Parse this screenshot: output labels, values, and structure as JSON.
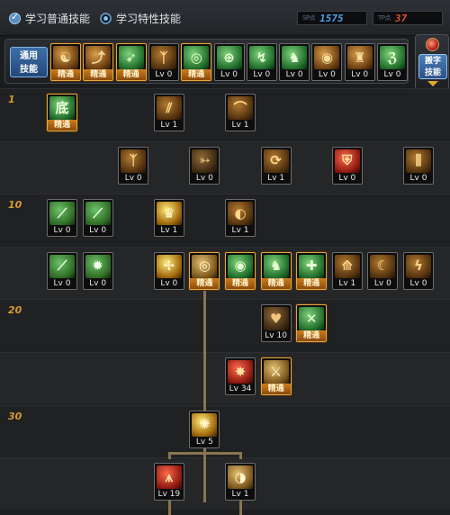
{
  "header": {
    "learn_common": "学习普通技能",
    "learn_special": "学习特性技能",
    "sp": {
      "tag": "SP点",
      "value": "1575",
      "color": "#4fa0e8"
    },
    "tp": {
      "tag": "TP点",
      "value": "37",
      "color": "#e2532b"
    }
  },
  "common_bar": {
    "label_line1": "通用",
    "label_line2": "技能",
    "skills": [
      {
        "icon": "meditate-icon",
        "glyph": "☯",
        "color": "c-gold",
        "level": "精通",
        "mastered": true
      },
      {
        "icon": "quick-rebound-icon",
        "glyph": "⤴",
        "color": "c-gold",
        "level": "精通",
        "mastered": true
      },
      {
        "icon": "dash-icon",
        "glyph": "➶",
        "color": "c-green",
        "level": "精通",
        "mastered": true
      },
      {
        "icon": "wing-icon",
        "glyph": "ᛉ",
        "color": "c-bronze",
        "level": "Lv 0",
        "mastered": false
      },
      {
        "icon": "aim-icon",
        "glyph": "◎",
        "color": "c-green",
        "level": "精通",
        "mastered": true
      },
      {
        "icon": "target-icon",
        "glyph": "⊕",
        "color": "c-green",
        "level": "Lv 0",
        "mastered": false
      },
      {
        "icon": "leap-icon",
        "glyph": "↯",
        "color": "c-green",
        "level": "Lv 0",
        "mastered": false
      },
      {
        "icon": "crouch-icon",
        "glyph": "♞",
        "color": "c-green",
        "level": "Lv 0",
        "mastered": false
      },
      {
        "icon": "orb-icon",
        "glyph": "◉",
        "color": "c-gold",
        "level": "Lv 0",
        "mastered": false
      },
      {
        "icon": "muscle-icon",
        "glyph": "♜",
        "color": "c-gold",
        "level": "Lv 0",
        "mastered": false
      },
      {
        "icon": "kick-icon",
        "glyph": "ℨ",
        "color": "c-green",
        "level": "Lv 0",
        "mastered": false
      }
    ]
  },
  "side_button": {
    "line1": "搬字",
    "line2": "技能"
  },
  "tree": {
    "level_labels": [
      "1",
      "10",
      "20",
      "30"
    ],
    "rows": [
      [
        {
          "icon": "base-skill-icon",
          "glyph": "底",
          "color": "c-green",
          "level": "精通",
          "mastered": true,
          "col": 0
        },
        {
          "icon": "claw-strike-icon",
          "glyph": "⫽",
          "color": "c-bronze",
          "level": "Lv 1",
          "mastered": false,
          "col": 3
        },
        {
          "icon": "slash-arc-icon",
          "glyph": "⌒",
          "color": "c-bronze",
          "level": "Lv 1",
          "mastered": false,
          "col": 5
        }
      ],
      [
        {
          "icon": "wing-burst-icon",
          "glyph": "ᛉ",
          "color": "c-bronze",
          "level": "Lv 0",
          "mastered": false,
          "col": 2
        },
        {
          "icon": "arrow-strike-icon",
          "glyph": "➳",
          "color": "c-dark",
          "level": "Lv 0",
          "mastered": false,
          "col": 4
        },
        {
          "icon": "spin-slash-icon",
          "glyph": "⟳",
          "color": "c-bronze",
          "level": "Lv 1",
          "mastered": false,
          "col": 6
        },
        {
          "icon": "shield-icon",
          "glyph": "⛨",
          "color": "c-red",
          "level": "Lv 0",
          "mastered": false,
          "col": 8
        },
        {
          "icon": "triple-blade-icon",
          "glyph": "⫼",
          "color": "c-bronze",
          "level": "Lv 0",
          "mastered": false,
          "col": 10
        }
      ],
      [
        {
          "icon": "green-blade-icon",
          "glyph": "⟋",
          "color": "c-ltgreen",
          "level": "Lv 0",
          "mastered": false,
          "col": 0
        },
        {
          "icon": "green-sword-icon",
          "glyph": "⟋",
          "color": "c-ltgreen",
          "level": "Lv 0",
          "mastered": false,
          "col": 1
        },
        {
          "icon": "crown-flame-icon",
          "glyph": "♛",
          "color": "c-yellow",
          "level": "Lv 1",
          "mastered": false,
          "col": 3
        },
        {
          "icon": "vortex-icon",
          "glyph": "◐",
          "color": "c-bronze",
          "level": "Lv 1",
          "mastered": false,
          "col": 5
        }
      ],
      [
        {
          "icon": "long-sword-icon",
          "glyph": "⟋",
          "color": "c-ltgreen",
          "level": "Lv 0",
          "mastered": false,
          "col": 0
        },
        {
          "icon": "burst-star-icon",
          "glyph": "✹",
          "color": "c-ltgreen",
          "level": "Lv 0",
          "mastered": false,
          "col": 1
        },
        {
          "icon": "spark-blade-icon",
          "glyph": "✢",
          "color": "c-yellow",
          "level": "Lv 0",
          "mastered": false,
          "col": 3
        },
        {
          "icon": "eye-ring-icon",
          "glyph": "◎",
          "color": "c-tan",
          "level": "精通",
          "mastered": true,
          "col": 4
        },
        {
          "icon": "green-eye-icon",
          "glyph": "◉",
          "color": "c-green",
          "level": "精通",
          "mastered": true,
          "col": 5
        },
        {
          "icon": "strength-icon",
          "glyph": "♞",
          "color": "c-green",
          "level": "精通",
          "mastered": true,
          "col": 6
        },
        {
          "icon": "holy-cross-icon",
          "glyph": "✚",
          "color": "c-green",
          "level": "精通",
          "mastered": true,
          "col": 7
        },
        {
          "icon": "rising-blade-icon",
          "glyph": "⟰",
          "color": "c-bronze",
          "level": "Lv 1",
          "mastered": false,
          "col": 8
        },
        {
          "icon": "crescent-icon",
          "glyph": "☾",
          "color": "c-bronze",
          "level": "Lv 0",
          "mastered": false,
          "col": 9
        },
        {
          "icon": "flame-slash-icon",
          "glyph": "ϟ",
          "color": "c-bronze",
          "level": "Lv 0",
          "mastered": false,
          "col": 10
        }
      ],
      [
        {
          "icon": "heart-shield-icon",
          "glyph": "♥",
          "color": "c-dark",
          "level": "Lv 10",
          "mastered": false,
          "col": 6
        },
        {
          "icon": "green-cross-slash-icon",
          "glyph": "✕",
          "color": "c-green",
          "level": "精通",
          "mastered": true,
          "col": 7
        }
      ],
      [
        {
          "icon": "red-burst-icon",
          "glyph": "✸",
          "color": "c-red",
          "level": "Lv 34",
          "mastered": false,
          "col": 5
        },
        {
          "icon": "golden-strike-icon",
          "glyph": "⚔",
          "color": "c-tan",
          "level": "精通",
          "mastered": true,
          "col": 6
        }
      ],
      [
        {
          "icon": "explosion-icon",
          "glyph": "✺",
          "color": "c-yellow",
          "level": "Lv 5",
          "mastered": false,
          "col": 4
        }
      ],
      [
        {
          "icon": "fire-wave-icon",
          "glyph": "⩚",
          "color": "c-red",
          "level": "Lv 19",
          "mastered": false,
          "col": 3
        },
        {
          "icon": "cyclone-icon",
          "glyph": "◑",
          "color": "c-tan",
          "level": "Lv 1",
          "mastered": false,
          "col": 5
        }
      ]
    ]
  }
}
